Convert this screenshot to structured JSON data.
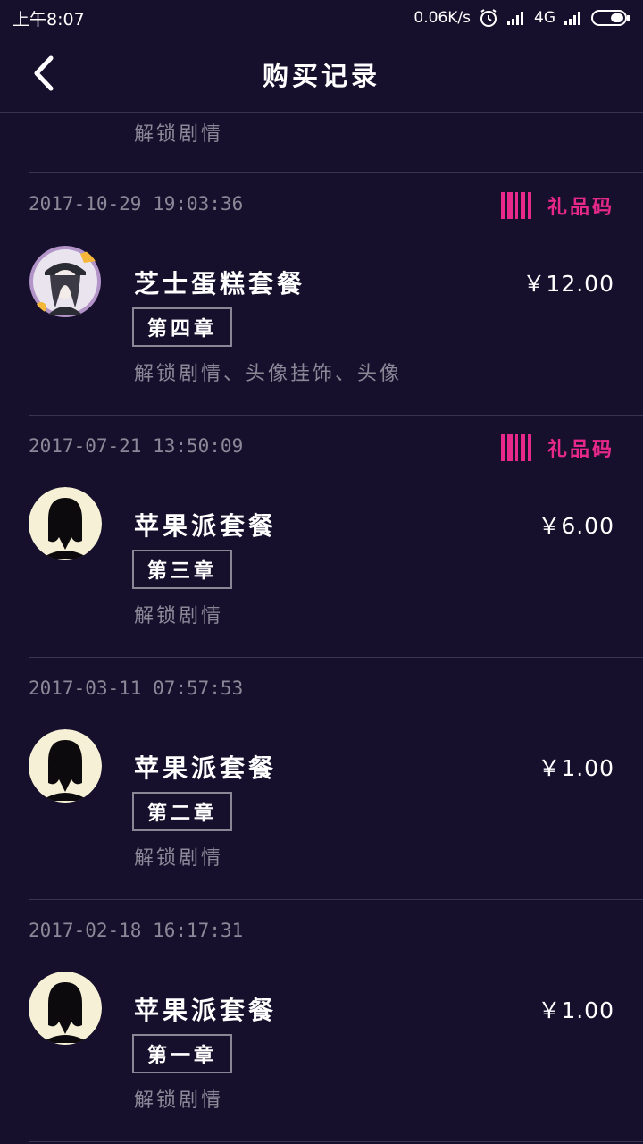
{
  "status_bar": {
    "time": "上午8:07",
    "speed": "0.06K/s",
    "network": "4G"
  },
  "header": {
    "title": "购买记录"
  },
  "partial_record": {
    "desc": "解锁剧情"
  },
  "gift_code_label": "礼品码",
  "records": [
    {
      "time": "2017-10-29 19:03:36",
      "has_gift_code": true,
      "name": "芝士蛋糕套餐",
      "price": "￥12.00",
      "chapter": "第四章",
      "desc": "解锁剧情、头像挂饰、头像",
      "avatar": "girl-cap-avatar-icon"
    },
    {
      "time": "2017-07-21 13:50:09",
      "has_gift_code": true,
      "name": "苹果派套餐",
      "price": "￥6.00",
      "chapter": "第三章",
      "desc": "解锁剧情",
      "avatar": "silhouette-avatar-icon"
    },
    {
      "time": "2017-03-11 07:57:53",
      "has_gift_code": false,
      "name": "苹果派套餐",
      "price": "￥1.00",
      "chapter": "第二章",
      "desc": "解锁剧情",
      "avatar": "silhouette-avatar-icon"
    },
    {
      "time": "2017-02-18 16:17:31",
      "has_gift_code": false,
      "name": "苹果派套餐",
      "price": "￥1.00",
      "chapter": "第一章",
      "desc": "解锁剧情",
      "avatar": "silhouette-avatar-icon"
    }
  ],
  "colors": {
    "background": "#16102c",
    "accent": "#e8288a",
    "muted_text": "#8c8898",
    "divider": "#3a3450"
  }
}
